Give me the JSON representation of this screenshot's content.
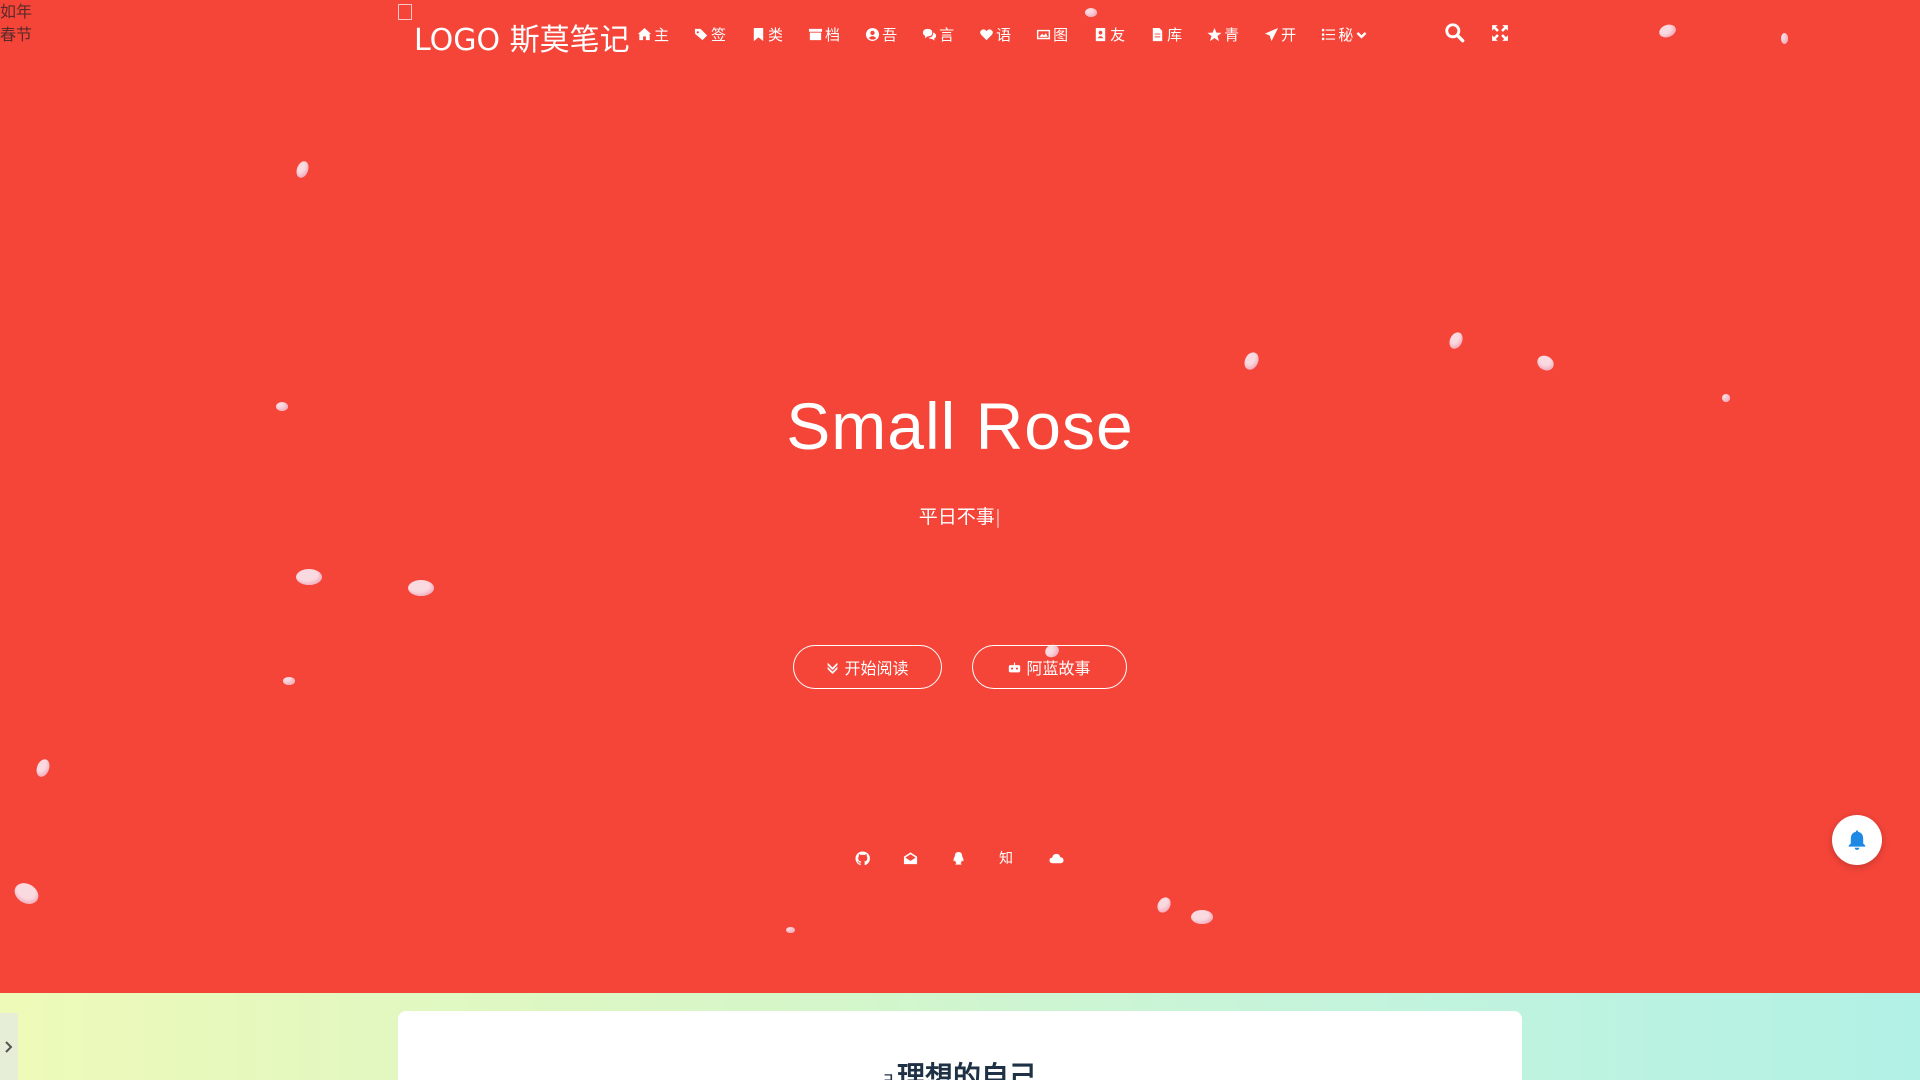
{
  "corner_note": {
    "line1": "如年",
    "line2": "春节"
  },
  "logo": {
    "alt_text": "LOGO",
    "site_name": "斯莫笔记"
  },
  "menu": [
    {
      "label": "主",
      "icon": "home-icon"
    },
    {
      "label": "签",
      "icon": "tags-icon"
    },
    {
      "label": "类",
      "icon": "bookmark-icon"
    },
    {
      "label": "档",
      "icon": "archive-icon"
    },
    {
      "label": "吾",
      "icon": "user-circle-icon"
    },
    {
      "label": "言",
      "icon": "comments-icon"
    },
    {
      "label": "语",
      "icon": "heartbeat-icon"
    },
    {
      "label": "图",
      "icon": "image-icon"
    },
    {
      "label": "友",
      "icon": "address-book-icon"
    },
    {
      "label": "库",
      "icon": "file-icon"
    },
    {
      "label": "青",
      "icon": "star-icon"
    },
    {
      "label": "开",
      "icon": "paper-plane-icon"
    },
    {
      "label": "秘",
      "icon": "list-icon",
      "has_dropdown": true
    }
  ],
  "nav_tools": {
    "search": "search-icon",
    "fullscreen": "expand-icon"
  },
  "hero": {
    "title": "Small Rose",
    "subtitle": "平日不事",
    "cursor": "|",
    "buttons": [
      {
        "label": "开始阅读",
        "icon": "angle-double-down-icon"
      },
      {
        "label": "阿蓝故事",
        "icon": "robot-icon"
      }
    ],
    "social": [
      {
        "icon": "github-icon",
        "text": ""
      },
      {
        "icon": "envelope-open-icon",
        "text": ""
      },
      {
        "icon": "qq-icon",
        "text": ""
      },
      {
        "icon": "zhihu-icon",
        "text": "知"
      },
      {
        "icon": "cloud-icon",
        "text": ""
      }
    ],
    "background_color": "#f54539"
  },
  "notification": {
    "icon": "bell-icon",
    "color": "#1e88e5"
  },
  "article": {
    "title_icon": "hook-icon",
    "title": "理想的自己"
  }
}
